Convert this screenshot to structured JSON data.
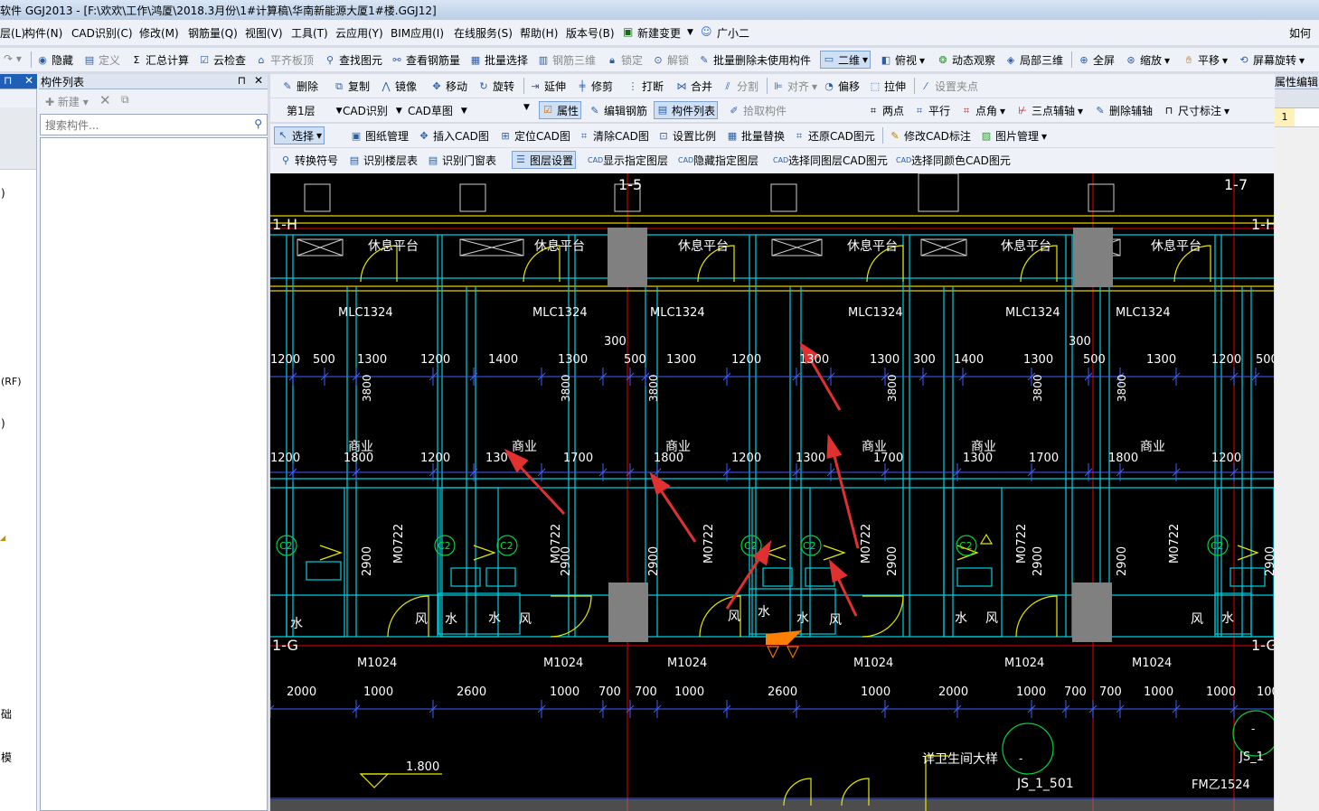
{
  "window": {
    "title": "软件 GGJ2013 - [F:\\欢欢\\工作\\鸿厦\\2018.3月份\\1#计算稿\\华南新能源大厦1#楼.GGJ12]"
  },
  "menu": {
    "items": [
      "层(L)",
      "构件(N)",
      "CAD识别(C)",
      "修改(M)",
      "钢筋量(Q)",
      "视图(V)",
      "工具(T)",
      "云应用(Y)",
      "BIM应用(I)",
      "在线服务(S)",
      "帮助(H)",
      "版本号(B)",
      "新建变更",
      "广小二"
    ],
    "right": "如何"
  },
  "toolbar1": {
    "items": [
      "隐藏",
      "定义",
      "汇总计算",
      "云检查",
      "平齐板顶",
      "查找图元",
      "查看钢筋量",
      "批量选择",
      "钢筋三维",
      "锁定",
      "解锁",
      "批量删除未使用构件",
      "二维",
      "俯视",
      "动态观察",
      "局部三维",
      "全屏",
      "缩放",
      "平移",
      "屏幕旋转"
    ],
    "right_label": "属性编辑"
  },
  "toolbar2": {
    "items": [
      "删除",
      "复制",
      "镜像",
      "移动",
      "旋转",
      "延伸",
      "修剪",
      "打断",
      "合并",
      "分割",
      "对齐",
      "偏移",
      "拉伸",
      "设置夹点"
    ]
  },
  "toolbar3": {
    "floor": "第1层",
    "cad_recog": "CAD识别",
    "cad_draw": "CAD草图",
    "items": [
      "属性",
      "编辑钢筋",
      "构件列表",
      "拾取构件"
    ],
    "right_items": [
      "两点",
      "平行",
      "点角",
      "三点辅轴",
      "删除辅轴",
      "尺寸标注"
    ]
  },
  "toolbar4": {
    "items": [
      "选择",
      "图纸管理",
      "插入CAD图",
      "定位CAD图",
      "清除CAD图",
      "设置比例",
      "批量替换",
      "还原CAD图元",
      "修改CAD标注",
      "图片管理"
    ]
  },
  "toolbar5": {
    "items": [
      "转换符号",
      "识别楼层表",
      "识别门窗表",
      "图层设置",
      "显示指定图层",
      "隐藏指定图层",
      "选择同图层CAD图元",
      "选择同颜色CAD图元"
    ]
  },
  "left_panel": {
    "title": "构件列表",
    "new_label": "新建",
    "search_placeholder": "搜索构件...",
    "side_labels": [
      ")",
      "(RF)",
      ")",
      "础",
      "模"
    ]
  },
  "right_panel": {
    "title": "属性编辑",
    "row_number": "1"
  },
  "cad": {
    "axis_labels": [
      "1-5",
      "1-7",
      "1-H",
      "1-H",
      "1-G",
      "1-G"
    ],
    "room_labels": [
      "休息平台",
      "休息平台",
      "休息平台",
      "休息平台",
      "休息平台",
      "休息平台"
    ],
    "window_labels": [
      "MLC1324",
      "MLC1324",
      "MLC1324",
      "MLC1324",
      "MLC1324",
      "MLC1324"
    ],
    "dim_row1": [
      "1200",
      "500",
      "1300",
      "1200",
      "1400",
      "1300",
      "500",
      "1300",
      "1200",
      "1300",
      "1300",
      "300",
      "1400",
      "1300",
      "500",
      "1300",
      "1200",
      "500"
    ],
    "dim_300": [
      "300",
      "300"
    ],
    "dim_row2": [
      "1200",
      "1800",
      "1200",
      "130",
      "1700",
      "1800",
      "1200",
      "1300",
      "1700",
      "1300",
      "1700",
      "1800",
      "1200"
    ],
    "commercial": [
      "商业",
      "商业",
      "商业",
      "商业",
      "商业",
      "商业"
    ],
    "vert_dims": [
      "3800",
      "3800",
      "3800",
      "3800",
      "3800",
      "3800"
    ],
    "door_labels_v": [
      "M0722",
      "M0722",
      "M0722",
      "M0722",
      "M0722",
      "M0722"
    ],
    "vert_2900": [
      "2900",
      "2900",
      "2900",
      "2900",
      "2900",
      "2900",
      "2900"
    ],
    "c2": [
      "C2",
      "C2",
      "C2",
      "C2",
      "C2",
      "C2",
      "C2",
      "C2"
    ],
    "fixtures": [
      "水",
      "风",
      "水",
      "水",
      "风",
      "风",
      "水",
      "水",
      "风",
      "水",
      "风",
      "风",
      "水"
    ],
    "door_bottom": [
      "M1024",
      "M1024",
      "M1024",
      "M1024",
      "M1024",
      "M1024"
    ],
    "dim_row3": [
      "2000",
      "1000",
      "2600",
      "1000",
      "700",
      "700",
      "1000",
      "2600",
      "1000",
      "2000",
      "1000",
      "700",
      "700",
      "1000",
      "1000",
      "1000"
    ],
    "elevation": "1.800",
    "detail_title": "详卫生间大样",
    "detail_ref": "JS_1_501",
    "detail_ref2": "JS_1",
    "fm_label": "FM乙1524",
    "dash": "-"
  }
}
